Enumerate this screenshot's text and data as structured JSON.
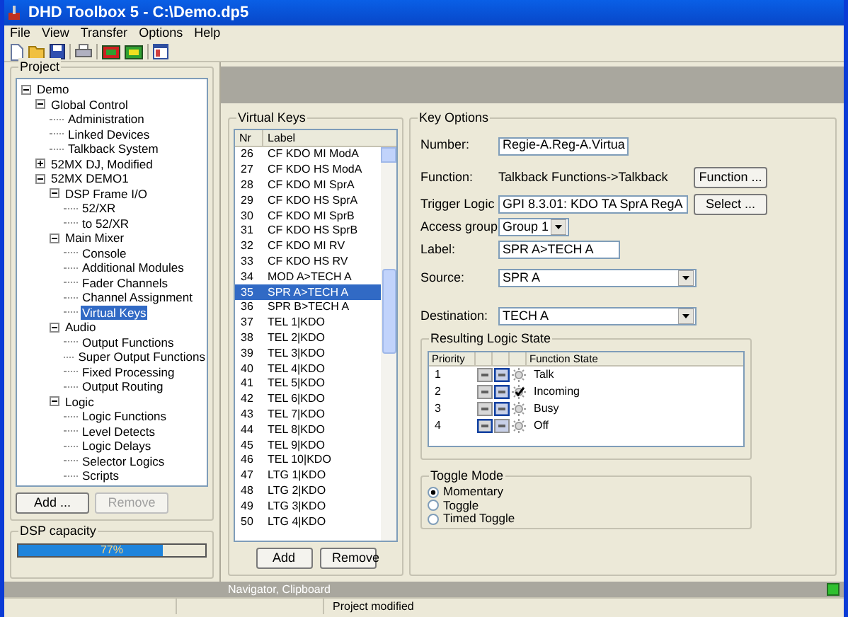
{
  "window": {
    "title": "DHD Toolbox 5 - C:\\Demo.dp5"
  },
  "menu": [
    "File",
    "View",
    "Transfer",
    "Options",
    "Help"
  ],
  "project": {
    "title": "Project",
    "tree": [
      {
        "label": "Demo",
        "expanded": true,
        "selected": false,
        "children": [
          {
            "label": "Global Control",
            "expanded": true,
            "selected": false,
            "children": [
              {
                "label": "Administration",
                "selected": false
              },
              {
                "label": "Linked Devices",
                "selected": false
              },
              {
                "label": "Talkback System",
                "selected": false
              }
            ]
          },
          {
            "label": "52MX DJ, Modified",
            "expanded": false,
            "selected": false
          },
          {
            "label": "52MX DEMO1",
            "expanded": true,
            "selected": false,
            "children": [
              {
                "label": "DSP Frame I/O",
                "expanded": true,
                "selected": false,
                "children": [
                  {
                    "label": "52/XR",
                    "selected": false
                  },
                  {
                    "label": "to 52/XR",
                    "selected": false
                  }
                ]
              },
              {
                "label": "Main Mixer",
                "expanded": true,
                "selected": false,
                "children": [
                  {
                    "label": "Console",
                    "selected": false
                  },
                  {
                    "label": "Additional Modules",
                    "selected": false
                  },
                  {
                    "label": "Fader Channels",
                    "selected": false
                  },
                  {
                    "label": "Channel Assignment",
                    "selected": false
                  },
                  {
                    "label": "Virtual Keys",
                    "selected": true
                  }
                ]
              },
              {
                "label": "Audio",
                "expanded": true,
                "selected": false,
                "children": [
                  {
                    "label": "Output Functions",
                    "selected": false
                  },
                  {
                    "label": "Super Output Functions",
                    "selected": false
                  },
                  {
                    "label": "Fixed Processing",
                    "selected": false
                  },
                  {
                    "label": "Output Routing",
                    "selected": false
                  }
                ]
              },
              {
                "label": "Logic",
                "expanded": true,
                "selected": false,
                "children": [
                  {
                    "label": "Logic Functions",
                    "selected": false
                  },
                  {
                    "label": "Level Detects",
                    "selected": false
                  },
                  {
                    "label": "Logic Delays",
                    "selected": false
                  },
                  {
                    "label": "Selector Logics",
                    "selected": false
                  },
                  {
                    "label": "Scripts",
                    "selected": false
                  }
                ]
              }
            ]
          }
        ]
      }
    ],
    "buttons": [
      {
        "label": "Add ...",
        "disabled": false
      },
      {
        "label": "Remove",
        "disabled": true
      }
    ]
  },
  "dsp_capacity": {
    "title": "DSP capacity",
    "level": 0.77,
    "reading": "77%"
  },
  "virtual_keys": {
    "title": "Virtual Keys",
    "columns": [
      "Nr",
      "Label"
    ],
    "rows": [
      {
        "nr": "26",
        "label": "CF KDO MI ModA",
        "selected": false
      },
      {
        "nr": "27",
        "label": "CF KDO HS ModA",
        "selected": false
      },
      {
        "nr": "28",
        "label": "CF KDO MI SprA",
        "selected": false
      },
      {
        "nr": "29",
        "label": "CF KDO HS SprA",
        "selected": false
      },
      {
        "nr": "30",
        "label": "CF KDO MI SprB",
        "selected": false
      },
      {
        "nr": "31",
        "label": "CF KDO HS SprB",
        "selected": false
      },
      {
        "nr": "32",
        "label": "CF KDO MI RV",
        "selected": false
      },
      {
        "nr": "33",
        "label": "CF KDO HS RV",
        "selected": false
      },
      {
        "nr": "34",
        "label": "MOD A>TECH A",
        "selected": false
      },
      {
        "nr": "35",
        "label": "SPR A>TECH A",
        "selected": true
      },
      {
        "nr": "36",
        "label": "SPR B>TECH A",
        "selected": false
      },
      {
        "nr": "37",
        "label": "TEL 1|KDO",
        "selected": false
      },
      {
        "nr": "38",
        "label": "TEL 2|KDO",
        "selected": false
      },
      {
        "nr": "39",
        "label": "TEL 3|KDO",
        "selected": false
      },
      {
        "nr": "40",
        "label": "TEL 4|KDO",
        "selected": false
      },
      {
        "nr": "41",
        "label": "TEL 5|KDO",
        "selected": false
      },
      {
        "nr": "42",
        "label": "TEL 6|KDO",
        "selected": false
      },
      {
        "nr": "43",
        "label": "TEL 7|KDO",
        "selected": false
      },
      {
        "nr": "44",
        "label": "TEL 8|KDO",
        "selected": false
      },
      {
        "nr": "45",
        "label": "TEL 9|KDO",
        "selected": false
      },
      {
        "nr": "46",
        "label": "TEL 10|KDO",
        "selected": false
      },
      {
        "nr": "47",
        "label": "LTG 1|KDO",
        "selected": false
      },
      {
        "nr": "48",
        "label": "LTG 2|KDO",
        "selected": false
      },
      {
        "nr": "49",
        "label": "LTG 3|KDO",
        "selected": false
      },
      {
        "nr": "50",
        "label": "LTG 4|KDO",
        "selected": false
      }
    ],
    "buttons": [
      "Add",
      "Remove"
    ]
  },
  "key_options": {
    "title": "Key Options",
    "number": {
      "label": "Number:",
      "value": "Regie-A.Reg-A.Virtua"
    },
    "function": {
      "label": "Function:",
      "value": "Talkback Functions->Talkback",
      "button": "Function ..."
    },
    "trigger_logic": {
      "label": "Trigger Logic",
      "value": "GPI 8.3.01: KDO TA SprA RegA",
      "button": "Select ..."
    },
    "access_group": {
      "label": "Access group",
      "value": "Group 1"
    },
    "label": {
      "label": "Label:",
      "value": "SPR A>TECH A"
    },
    "source": {
      "label": "Source:",
      "value": "SPR A"
    },
    "destination": {
      "label": "Destination:",
      "value": "TECH A"
    },
    "logic_state": {
      "title": "Resulting Logic State",
      "columns": [
        "Priority",
        "Function State"
      ],
      "rows": [
        {
          "priority": "1",
          "on_selected": true,
          "lamp_checked": false,
          "function_state": "Talk"
        },
        {
          "priority": "2",
          "on_selected": true,
          "lamp_checked": true,
          "function_state": "Incoming"
        },
        {
          "priority": "3",
          "on_selected": true,
          "lamp_checked": false,
          "function_state": "Busy"
        },
        {
          "priority": "4",
          "on_selected": false,
          "lamp_checked": false,
          "function_state": "Off"
        }
      ]
    },
    "toggle_mode": {
      "title": "Toggle Mode",
      "options": [
        {
          "label": "Momentary",
          "selected": true
        },
        {
          "label": "Toggle",
          "selected": false
        },
        {
          "label": "Timed Toggle",
          "selected": false
        }
      ]
    }
  },
  "navigator_bar": "Navigator, Clipboard",
  "status_bar": "Project modified"
}
